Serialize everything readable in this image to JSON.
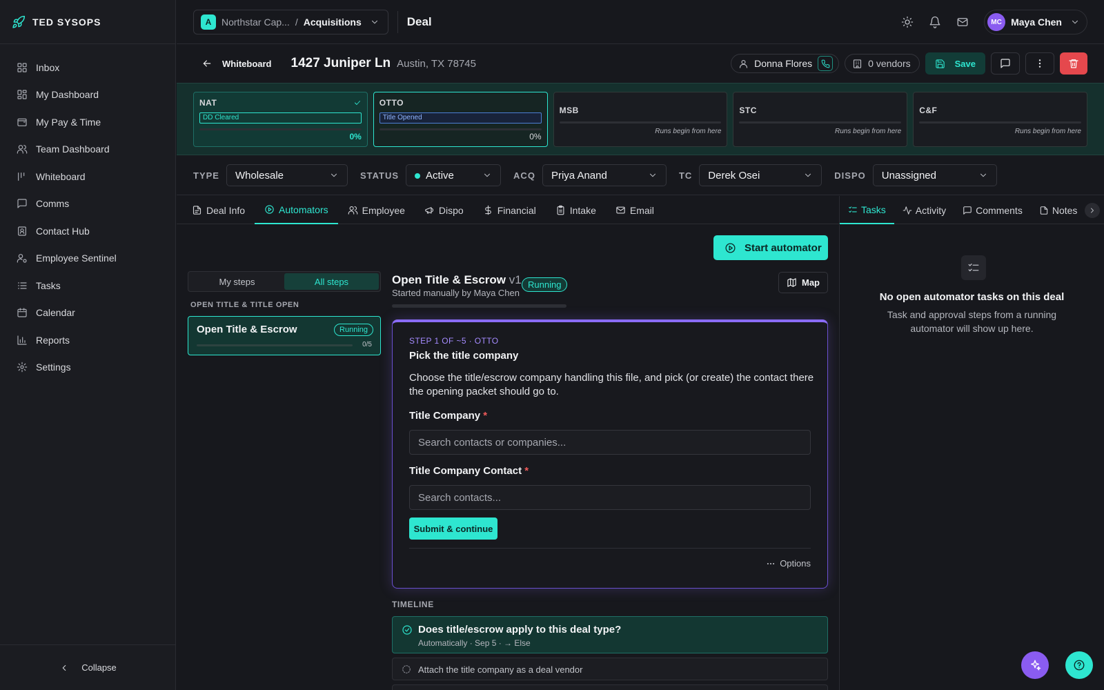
{
  "app": {
    "brand": "TED SYSOPS"
  },
  "sidebar": {
    "items": [
      {
        "label": "Inbox",
        "icon": "inbox-icon"
      },
      {
        "label": "My Dashboard",
        "icon": "dashboard-icon"
      },
      {
        "label": "My Pay & Time",
        "icon": "wallet-icon"
      },
      {
        "label": "Team Dashboard",
        "icon": "users-icon"
      },
      {
        "label": "Whiteboard",
        "icon": "whiteboard-icon"
      },
      {
        "label": "Comms",
        "icon": "message-icon"
      },
      {
        "label": "Contact Hub",
        "icon": "contact-icon"
      },
      {
        "label": "Employee Sentinel",
        "icon": "user-cog-icon"
      },
      {
        "label": "Tasks",
        "icon": "list-icon"
      },
      {
        "label": "Calendar",
        "icon": "calendar-icon"
      },
      {
        "label": "Reports",
        "icon": "chart-icon"
      },
      {
        "label": "Settings",
        "icon": "gear-icon"
      }
    ],
    "collapse_label": "Collapse"
  },
  "topbar": {
    "org_initial": "A",
    "org_name": "Northstar Cap...",
    "org_sep": "/",
    "department": "Acquisitions",
    "page_title": "Deal",
    "user_initials": "MC",
    "user_name": "Maya Chen"
  },
  "deal": {
    "back_label": "Whiteboard",
    "address": "1427 Juniper Ln",
    "city": "Austin, TX 78745",
    "contact_name": "Donna Flores",
    "vendors": "0 vendors",
    "save_label": "Save"
  },
  "stages": [
    {
      "name": "NAT",
      "chip": "DD Cleared",
      "percent": "0%",
      "state": "done"
    },
    {
      "name": "OTTO",
      "chip": "Title Opened",
      "percent": "0%",
      "state": "current"
    },
    {
      "name": "MSB",
      "note": "Runs begin from here",
      "state": "locked"
    },
    {
      "name": "STC",
      "note": "Runs begin from here",
      "state": "locked"
    },
    {
      "name": "C&F",
      "note": "Runs begin from here",
      "state": "locked"
    }
  ],
  "fields": {
    "type_label": "TYPE",
    "type_value": "Wholesale",
    "status_label": "STATUS",
    "status_value": "Active",
    "acq_label": "ACQ",
    "acq_value": "Priya Anand",
    "tc_label": "TC",
    "tc_value": "Derek Osei",
    "dispo_label": "DISPO",
    "dispo_value": "Unassigned"
  },
  "tabs": [
    "Deal Info",
    "Automators",
    "Employee",
    "Dispo",
    "Financial",
    "Intake",
    "Email"
  ],
  "right_tabs": [
    "Tasks",
    "Activity",
    "Comments",
    "Notes"
  ],
  "automators": {
    "start_label": "Start automator",
    "seg_mine": "My steps",
    "seg_all": "All steps",
    "group_label": "OPEN TITLE & TITLE OPEN",
    "card_title": "Open Title & Escrow",
    "card_status": "Running",
    "card_count": "0/5",
    "card_progress": 0,
    "run_title": "Open Title & Escrow",
    "run_version": "v1",
    "run_status": "Running",
    "run_sub": "Started manually by Maya Chen",
    "run_progress": 0,
    "map_label": "Map"
  },
  "step": {
    "kicker": "STEP 1 OF ~5 · OTTO",
    "title": "Pick the title company",
    "description": "Choose the title/escrow company handling this file, and pick (or create) the contact there the opening packet should go to.",
    "field1_label": "Title Company",
    "field1_placeholder": "Search contacts or companies...",
    "field2_label": "Title Company Contact",
    "field2_placeholder": "Search contacts...",
    "required_mark": "*",
    "submit_label": "Submit & continue",
    "options_label": "Options"
  },
  "timeline": {
    "label": "TIMELINE",
    "items": [
      {
        "title": "Does title/escrow apply to this deal type?",
        "sub": "Automatically · Sep 5 · → Else",
        "state": "done"
      },
      {
        "title": "Attach the title company as a deal vendor",
        "state": "pending"
      }
    ]
  },
  "right_panel": {
    "empty_title": "No open automator tasks on this deal",
    "empty_sub": "Task and approval steps from a running automator will show up here."
  },
  "colors": {
    "accent": "#2ee6d0",
    "purple": "#8a5cf0",
    "danger": "#e5484d",
    "bg": "#17181d"
  }
}
